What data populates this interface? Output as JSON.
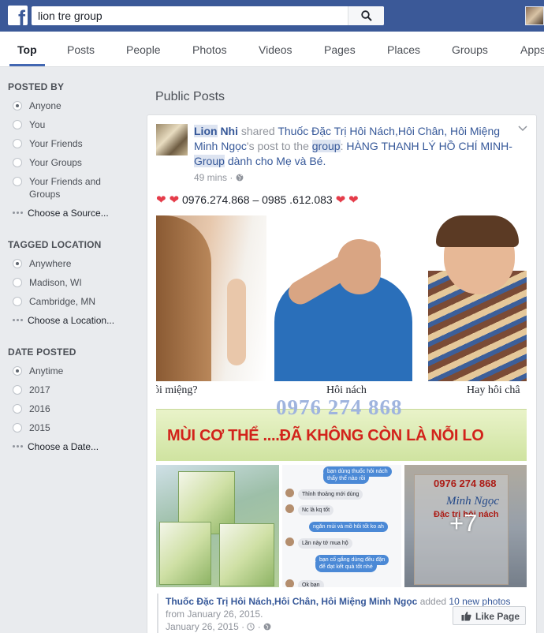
{
  "search": {
    "query": "lion tre group"
  },
  "tabs": [
    "Top",
    "Posts",
    "People",
    "Photos",
    "Videos",
    "Pages",
    "Places",
    "Groups",
    "Apps"
  ],
  "filters": {
    "posted_by": {
      "heading": "POSTED BY",
      "options": [
        "Anyone",
        "You",
        "Your Friends",
        "Your Groups",
        "Your Friends and",
        "Groups"
      ],
      "more": "Choose a Source..."
    },
    "tagged_location": {
      "heading": "TAGGED LOCATION",
      "options": [
        "Anywhere",
        "Madison, WI",
        "Cambridge, MN"
      ],
      "more": "Choose a Location..."
    },
    "date_posted": {
      "heading": "DATE POSTED",
      "options": [
        "Anytime",
        "2017",
        "2016",
        "2015"
      ],
      "more": "Choose a Date..."
    }
  },
  "section_title": "Public Posts",
  "post": {
    "author_first": "Lion",
    "author_last": "Nhi",
    "shared": "shared",
    "page_name": "Thuốc Đặc Trị Hôi Nách,Hôi Chân, Hôi Miệng Minh Ngọc",
    "possessive": "'s post to the",
    "group_word": "group",
    "colon": ":",
    "group_name_a": "HÀNG THANH LÝ HỒ CHÍ MINH-",
    "group_name_b": "Group",
    "group_name_c": "dành cho Mẹ và Bé.",
    "time": "49 mins",
    "phones": "0976.274.868 – 0985 .612.083",
    "image": {
      "caption_left": "ôi miệng?",
      "caption_mid": "Hôi nách",
      "caption_right": "Hay hôi châ",
      "watermark": "0976 274 868",
      "banner": "MÙI CƠ THỂ ....ĐÃ KHÔNG CÒN LÀ NỖI LO"
    },
    "thumb2_chat": [
      "bạn dùng thuốc hôi nách",
      "thấy thế nào rồi",
      "Thỉnh thoảng mới dùng",
      "Nc là kq tốt",
      "ngăn mùi và mồ hôi tốt ko ah",
      "Lần này tớ mua hộ",
      "bạn cố gắng dùng đều đặn",
      "để đạt kết quả tốt nhé",
      "Ok bạn"
    ],
    "thumb3": {
      "phone": "0976 274 868",
      "brand": "Minh Ngọc",
      "sub": "Đặc trị hôi nách",
      "more": "+7"
    },
    "attribution": {
      "page": "Thuốc Đặc Trị Hôi Nách,Hôi Chân, Hôi Miệng Minh Ngọc",
      "added": "added",
      "count": "10 new photos",
      "from": "from January 26, 2015.",
      "date": "January 26, 2015 ·"
    },
    "like_label": "Like Page"
  },
  "colors": {
    "brand": "#3b5998",
    "link": "#365899",
    "heart": "#e53c4a",
    "banner_text": "#d2231b"
  }
}
